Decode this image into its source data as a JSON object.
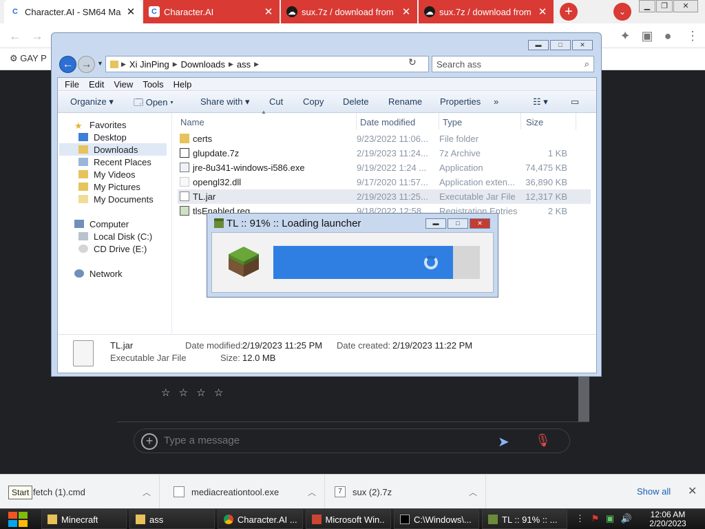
{
  "browser": {
    "tabs": [
      {
        "title": "Character.AI - SM64 Ma",
        "favicon": "C"
      },
      {
        "title": "Character.AI",
        "favicon": "C"
      },
      {
        "title": "sux.7z / download from",
        "favicon": "cloud"
      },
      {
        "title": "sux.7z / download from",
        "favicon": "cloud"
      }
    ],
    "new_tab": "+",
    "tab_search": "⌄",
    "bookmark": "GAY P"
  },
  "chat": {
    "rating_stars": "☆ ☆ ☆ ☆",
    "placeholder": "Type a message"
  },
  "explorer": {
    "breadcrumbs": [
      "Xi JinPing",
      "Downloads",
      "ass"
    ],
    "search_placeholder": "Search ass",
    "menu": [
      "File",
      "Edit",
      "View",
      "Tools",
      "Help"
    ],
    "commands": [
      "Organize",
      "Open",
      "Share with",
      "Cut",
      "Copy",
      "Delete",
      "Rename",
      "Properties",
      "»"
    ],
    "nav": {
      "favorites": "Favorites",
      "favorite_items": [
        "Desktop",
        "Downloads",
        "Recent Places",
        "My Videos",
        "My Pictures",
        "My Documents"
      ],
      "computer": "Computer",
      "computer_items": [
        "Local Disk (C:)",
        "CD Drive (E:)"
      ],
      "network": "Network"
    },
    "columns": [
      "Name",
      "Date modified",
      "Type",
      "Size"
    ],
    "files": [
      {
        "name": "certs",
        "date": "9/23/2022 11:06...",
        "type": "File folder",
        "size": ""
      },
      {
        "name": "glupdate.7z",
        "date": "2/19/2023 11:24...",
        "type": "7z Archive",
        "size": "1 KB"
      },
      {
        "name": "jre-8u341-windows-i586.exe",
        "date": "9/19/2022 1:24 ...",
        "type": "Application",
        "size": "74,475 KB"
      },
      {
        "name": "opengl32.dll",
        "date": "9/17/2020 11:57...",
        "type": "Application exten...",
        "size": "36,890 KB"
      },
      {
        "name": "TL.jar",
        "date": "2/19/2023 11:25...",
        "type": "Executable Jar File",
        "size": "12,317 KB"
      },
      {
        "name": "tlsEnabled.reg",
        "date": "9/18/2022 12:58...",
        "type": "Registration Entries",
        "size": "2 KB"
      }
    ],
    "details": {
      "name": "TL.jar",
      "type": "Executable Jar File",
      "date_modified_label": "Date modified:",
      "date_modified": "2/19/2023 11:25 PM",
      "date_created_label": "Date created:",
      "date_created": "2/19/2023 11:22 PM",
      "size_label": "Size:",
      "size": "12.0 MB"
    }
  },
  "launcher": {
    "title": "TL :: 91% :: Loading launcher",
    "progress": 0.87
  },
  "downloads": {
    "items": [
      "fetch (1).cmd",
      "mediacreationtool.exe",
      "sux (2).7z"
    ],
    "show_all": "Show all",
    "start_tooltip": "Start"
  },
  "taskbar": {
    "items": [
      "Minecraft",
      "ass",
      "Character.AI ...",
      "Microsoft Win...",
      "C:\\Windows\\...",
      "TL :: 91% :: ..."
    ],
    "time": "12:06 AM",
    "date": "2/20/2023"
  }
}
